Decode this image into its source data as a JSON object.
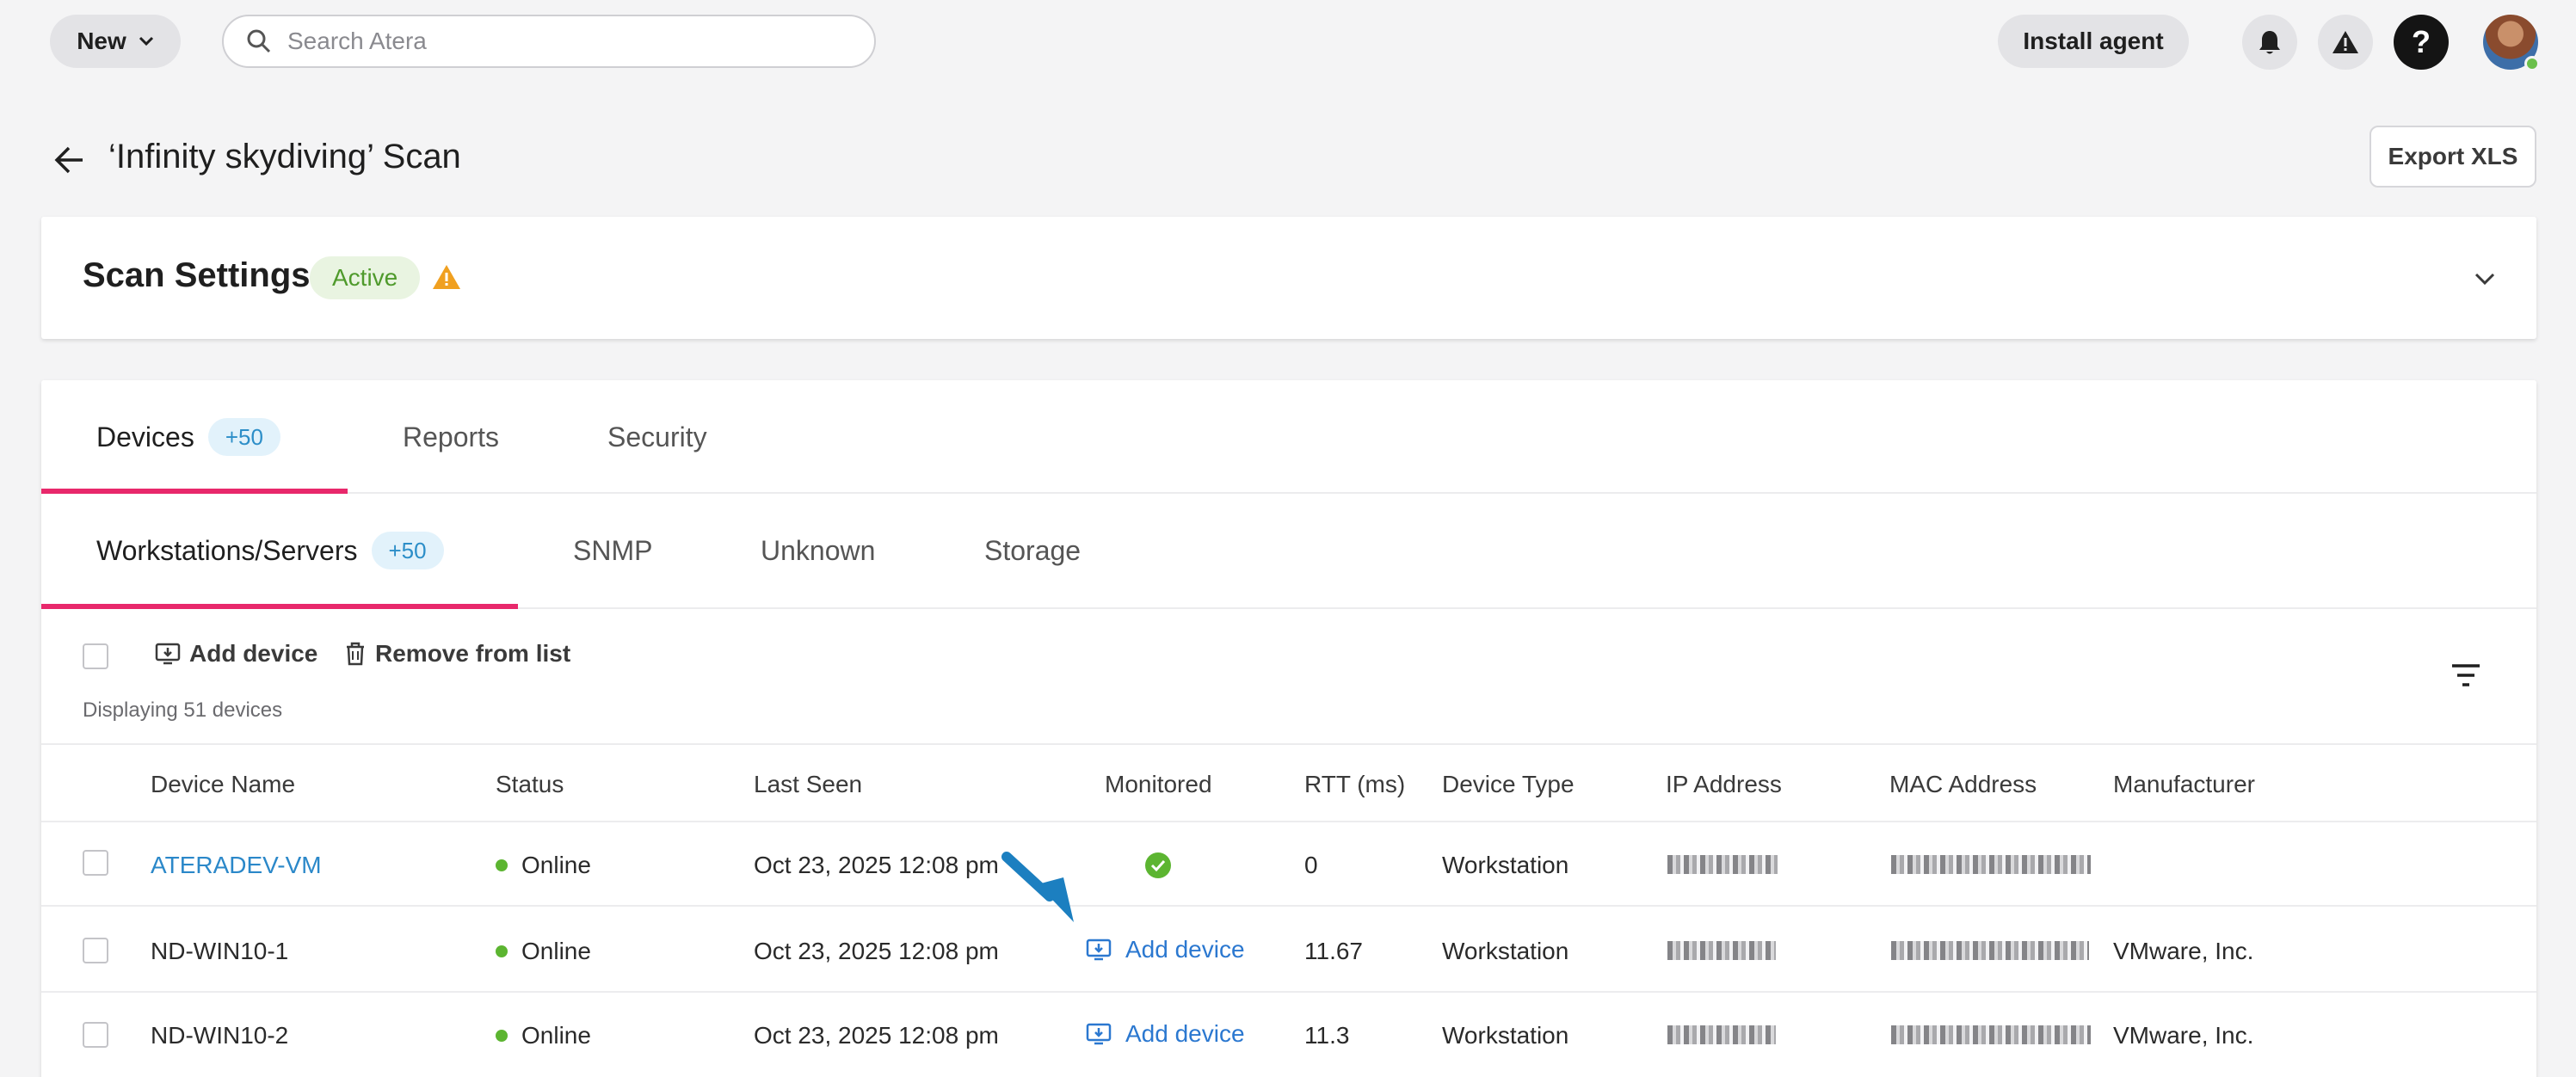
{
  "topbar": {
    "new_label": "New",
    "search_placeholder": "Search Atera",
    "install_label": "Install agent",
    "help_label": "?"
  },
  "page": {
    "title": "‘Infinity skydiving’ Scan",
    "export_label": "Export XLS"
  },
  "scan_settings": {
    "title": "Scan Settings",
    "status": "Active",
    "status_color": "#4f9a2c"
  },
  "tabs": [
    {
      "label": "Devices",
      "badge": "+50",
      "active": true
    },
    {
      "label": "Reports"
    },
    {
      "label": "Security"
    }
  ],
  "subtabs": [
    {
      "label": "Workstations/Servers",
      "badge": "+50",
      "active": true
    },
    {
      "label": "SNMP"
    },
    {
      "label": "Unknown"
    },
    {
      "label": "Storage"
    }
  ],
  "toolbar": {
    "add_device": "Add device",
    "remove_from_list": "Remove from list",
    "displaying": "Displaying 51 devices"
  },
  "table": {
    "columns": [
      "Device Name",
      "Status",
      "Last Seen",
      "Monitored",
      "RTT (ms)",
      "Device Type",
      "IP Address",
      "MAC Address",
      "Manufacturer"
    ],
    "rows": [
      {
        "name": "ATERADEV-VM",
        "status": "Online",
        "last_seen": "Oct 23, 2025 12:08 pm",
        "monitored": "check",
        "rtt": "0",
        "type": "Workstation",
        "manufacturer": ""
      },
      {
        "name": "ND-WIN10-1",
        "status": "Online",
        "last_seen": "Oct 23, 2025 12:08 pm",
        "monitored": "Add device",
        "rtt": "11.67",
        "type": "Workstation",
        "manufacturer": "VMware, Inc."
      },
      {
        "name": "ND-WIN10-2",
        "status": "Online",
        "last_seen": "Oct 23, 2025 12:08 pm",
        "monitored": "Add device",
        "rtt": "11.3",
        "type": "Workstation",
        "manufacturer": "VMware, Inc."
      }
    ]
  },
  "colors": {
    "accent_pink": "#e8286b",
    "link_blue": "#2b88c9",
    "online_green": "#5cb531",
    "warning_amber": "#f0a020"
  }
}
